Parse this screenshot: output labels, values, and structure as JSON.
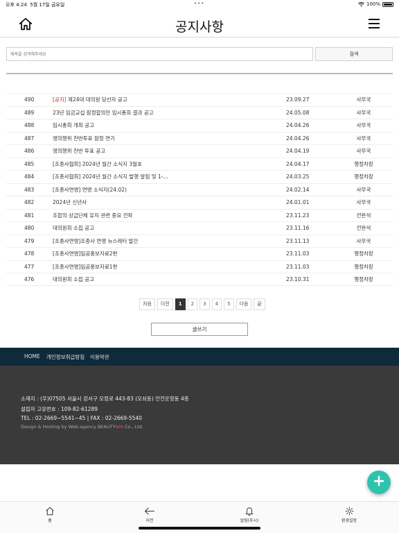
{
  "status": {
    "time": "오후 4:24",
    "date": "5월 17일 금요일",
    "battery": "100%"
  },
  "header": {
    "title": "공지사항"
  },
  "search": {
    "placeholder": "제목을 검색해주세요",
    "button_label": "검색"
  },
  "notices": [
    {
      "num": "490",
      "tag": "[공지]",
      "subject": " 제24대 대의원 당선자 공고",
      "date": "23.09.27",
      "author": "사무국"
    },
    {
      "num": "489",
      "tag": "",
      "subject": "23년 임금교섭 잠정합의안 임시총회 결과 공고",
      "date": "24.05.08",
      "author": "사무국"
    },
    {
      "num": "488",
      "tag": "",
      "subject": "임시총회 개최 공고",
      "date": "24.04.26",
      "author": "사무국"
    },
    {
      "num": "487",
      "tag": "",
      "subject": "쟁의행위 찬반투표 잠정 연기",
      "date": "24.04.26",
      "author": "사무국"
    },
    {
      "num": "486",
      "tag": "",
      "subject": "쟁의행위 찬반 투표 공고",
      "date": "24.04.19",
      "author": "사무국"
    },
    {
      "num": "485",
      "tag": "",
      "subject": "[조종사협회] 2024년 월간 소식지 3월호",
      "date": "24.04.17",
      "author": "행정차장"
    },
    {
      "num": "484",
      "tag": "",
      "subject": "[조종사협회] 2024년 월간 소식지 발행 알림 및 1-...",
      "date": "24.03.25",
      "author": "행정차장"
    },
    {
      "num": "483",
      "tag": "",
      "subject": "[조종사연맹] 연맹 소식지(24.02)",
      "date": "24.02.14",
      "author": "사무국"
    },
    {
      "num": "482",
      "tag": "",
      "subject": "2024년 신년사",
      "date": "24.01.01",
      "author": "사무국"
    },
    {
      "num": "481",
      "tag": "",
      "subject": "조합의 상급단체 유지 관련 중요 전파",
      "date": "23.11.23",
      "author": "전완석"
    },
    {
      "num": "480",
      "tag": "",
      "subject": "대의원회 소집 공고",
      "date": "23.11.16",
      "author": "전완석"
    },
    {
      "num": "479",
      "tag": "",
      "subject": "[조종사연맹]조종사 연맹 뉴스레터 발간",
      "date": "23.11.13",
      "author": "사무국"
    },
    {
      "num": "478",
      "tag": "",
      "subject": "[조종사연맹]임공홍보자료2편",
      "date": "23.11.03",
      "author": "행정차장"
    },
    {
      "num": "477",
      "tag": "",
      "subject": "[조종사연맹]임공홍보자료1편",
      "date": "23.11.03",
      "author": "행정차장"
    },
    {
      "num": "476",
      "tag": "",
      "subject": "대의원회 소집 공고",
      "date": "23.10.31",
      "author": "행정차장"
    }
  ],
  "pagination": {
    "first": "처음",
    "prev": "이전",
    "pages": [
      "1",
      "2",
      "3",
      "4",
      "5"
    ],
    "current": "1",
    "next": "다음",
    "last": "끝"
  },
  "write_button": "글쓰기",
  "footer_nav": {
    "home": "HOME",
    "privacy": "개인정보취급방침",
    "terms": "이용약관"
  },
  "footer": {
    "address": "소재지 : (우)07505 서울시 강서구 오정로 443-83 (오쇠동) 안전운항동 4층",
    "business_no": "설립자 고유번호 : 109-82-61289",
    "tel_fax": "TEL : 02-2669~5541~45 | FAX : 02-2669-5540",
    "credit_prefix": "Design & Hosting by Web-agency BEA",
    "credit_b1": "U",
    "credit_mid": "TY",
    "credit_b2": "NIA",
    "credit_suffix": " Co., Ltd."
  },
  "fab": {
    "icon": "plus-icon"
  },
  "tabbar": {
    "home": "홈",
    "back": "이전",
    "alarm": "알림(푸시)",
    "settings": "환경설정"
  },
  "colors": {
    "accent": "#2ec3ad",
    "footer_nav_bg": "#0f2a3a",
    "footer_bg": "#3a3a3a",
    "notice_tag": "#c0312b"
  }
}
